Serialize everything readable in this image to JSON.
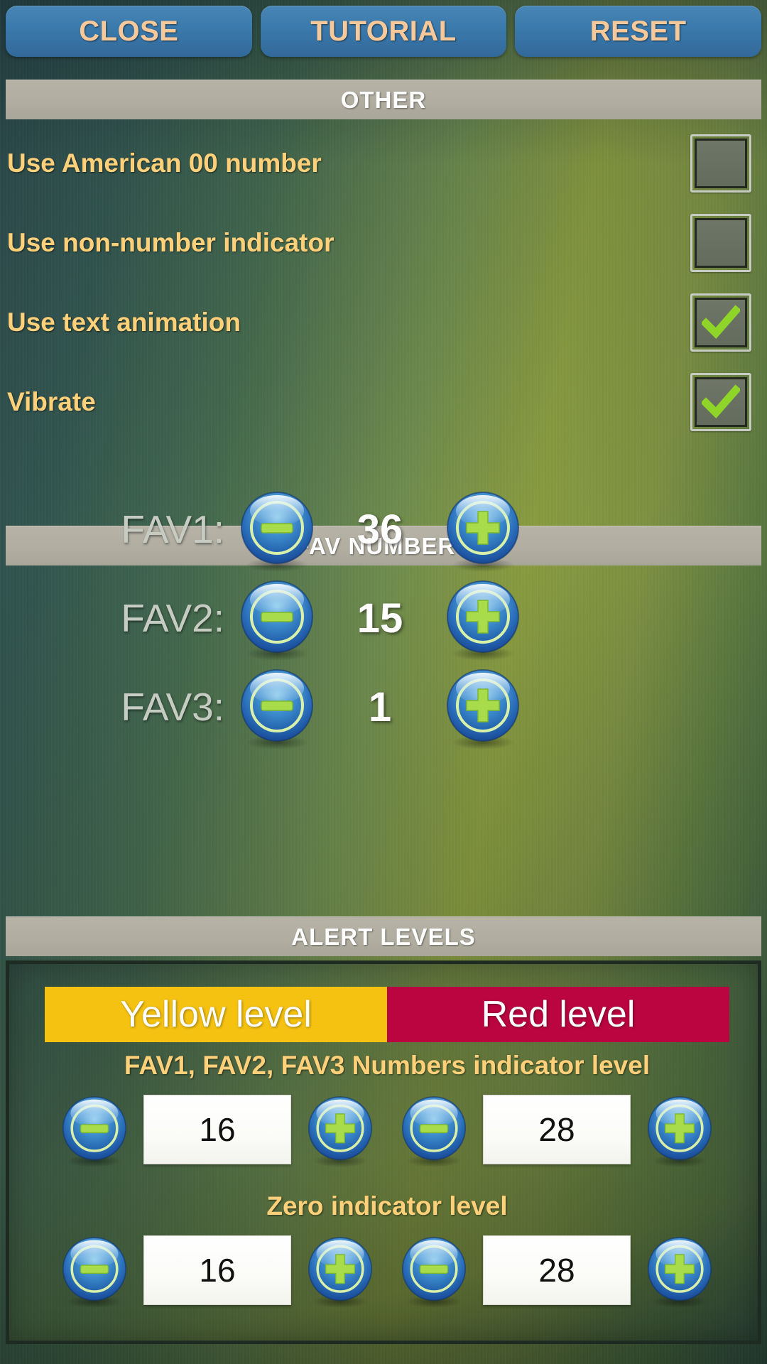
{
  "topbar": {
    "buttons": [
      {
        "label": "CLOSE",
        "name": "close-button"
      },
      {
        "label": "TUTORIAL",
        "name": "tutorial-button"
      },
      {
        "label": "RESET",
        "name": "reset-button"
      }
    ]
  },
  "sections": {
    "other": "OTHER",
    "fav_numbers": "FAV NUMBERS",
    "alert_levels": "ALERT LEVELS"
  },
  "options": [
    {
      "label": "Use American 00 number",
      "checked": false
    },
    {
      "label": "Use non-number indicator",
      "checked": false
    },
    {
      "label": "Use text animation",
      "checked": true
    },
    {
      "label": "Vibrate",
      "checked": true
    }
  ],
  "fav_numbers": [
    {
      "label": "FAV1:",
      "value": "36"
    },
    {
      "label": "FAV2:",
      "value": "15"
    },
    {
      "label": "FAV3:",
      "value": "1"
    }
  ],
  "alert_levels": {
    "tabs": [
      {
        "label": "Yellow level",
        "color": "#f5c211"
      },
      {
        "label": "Red level",
        "color": "#ba0540"
      }
    ],
    "groups": [
      {
        "title": "FAV1, FAV2, FAV3 Numbers indicator level",
        "yellow_value": "16",
        "red_value": "28"
      },
      {
        "title": "Zero indicator level",
        "yellow_value": "16",
        "red_value": "28"
      }
    ]
  },
  "icons": {
    "minus": "minus-icon",
    "plus": "plus-icon",
    "check": "check-icon"
  },
  "colors": {
    "label_accent": "#ffd07a",
    "button_blue": "#3a79ab",
    "button_text": "#f7c99a",
    "header_bar": "#b1aea1",
    "yellow": "#f5c211",
    "red": "#ba0540",
    "check_green": "#8fd428"
  }
}
